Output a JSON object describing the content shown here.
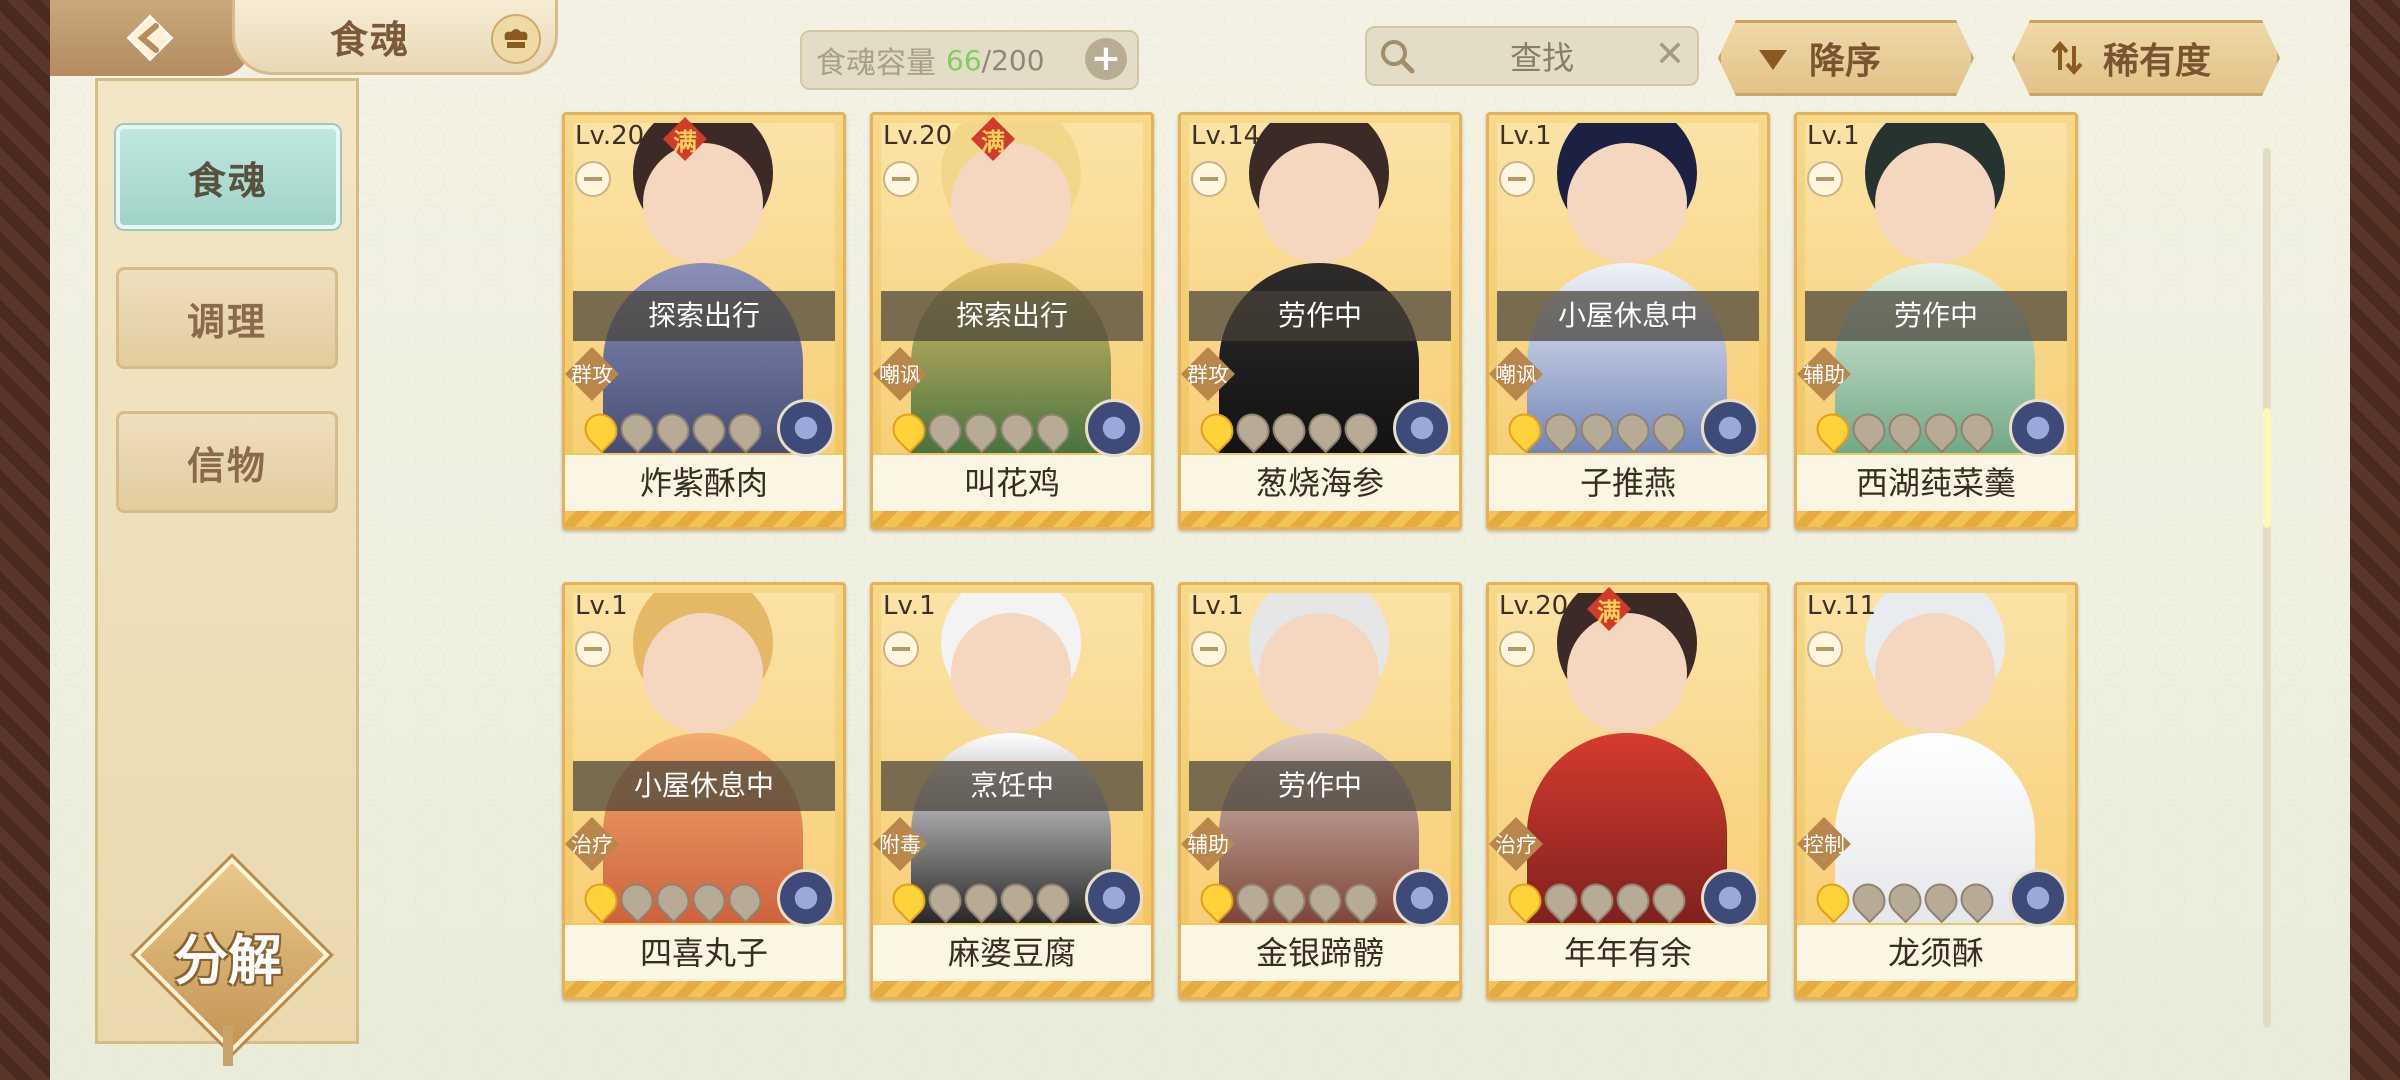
{
  "header": {
    "title": "食魂",
    "capacity_label": "食魂容量",
    "capacity_current": "66",
    "capacity_sep_max": "/200",
    "search_text": "查找",
    "sort_order_label": "降序",
    "rarity_label": "稀有度"
  },
  "sidebar": {
    "items": [
      {
        "label": "食魂"
      },
      {
        "label": "调理"
      },
      {
        "label": "信物"
      }
    ],
    "decompose_label": "分解"
  },
  "cards": [
    {
      "level": "Lv.20",
      "max": "满",
      "status": "探索出行",
      "role": "群攻",
      "stars_on": 1,
      "name": "炸紫酥肉"
    },
    {
      "level": "Lv.20",
      "max": "满",
      "status": "探索出行",
      "role": "嘲讽",
      "stars_on": 1,
      "name": "叫花鸡"
    },
    {
      "level": "Lv.14",
      "max": "",
      "status": "劳作中",
      "role": "群攻",
      "stars_on": 1,
      "name": "葱烧海参"
    },
    {
      "level": "Lv.1",
      "max": "",
      "status": "小屋休息中",
      "role": "嘲讽",
      "stars_on": 1,
      "name": "子推燕"
    },
    {
      "level": "Lv.1",
      "max": "",
      "status": "劳作中",
      "role": "辅助",
      "stars_on": 1,
      "name": "西湖莼菜羹"
    },
    {
      "level": "Lv.1",
      "max": "",
      "status": "小屋休息中",
      "role": "治疗",
      "stars_on": 1,
      "name": "四喜丸子"
    },
    {
      "level": "Lv.1",
      "max": "",
      "status": "烹饪中",
      "role": "附毒",
      "stars_on": 1,
      "name": "麻婆豆腐"
    },
    {
      "level": "Lv.1",
      "max": "",
      "status": "劳作中",
      "role": "辅助",
      "stars_on": 1,
      "name": "金银蹄髈"
    },
    {
      "level": "Lv.20",
      "max": "满",
      "status": "",
      "role": "治疗",
      "stars_on": 1,
      "name": "年年有余"
    },
    {
      "level": "Lv.11",
      "max": "",
      "status": "",
      "role": "控制",
      "stars_on": 1,
      "name": "龙须酥"
    }
  ],
  "colors": {
    "accent": "#e3b25a",
    "capacity_current": "#7fcf5a",
    "max_badge": "#d23b2a"
  }
}
